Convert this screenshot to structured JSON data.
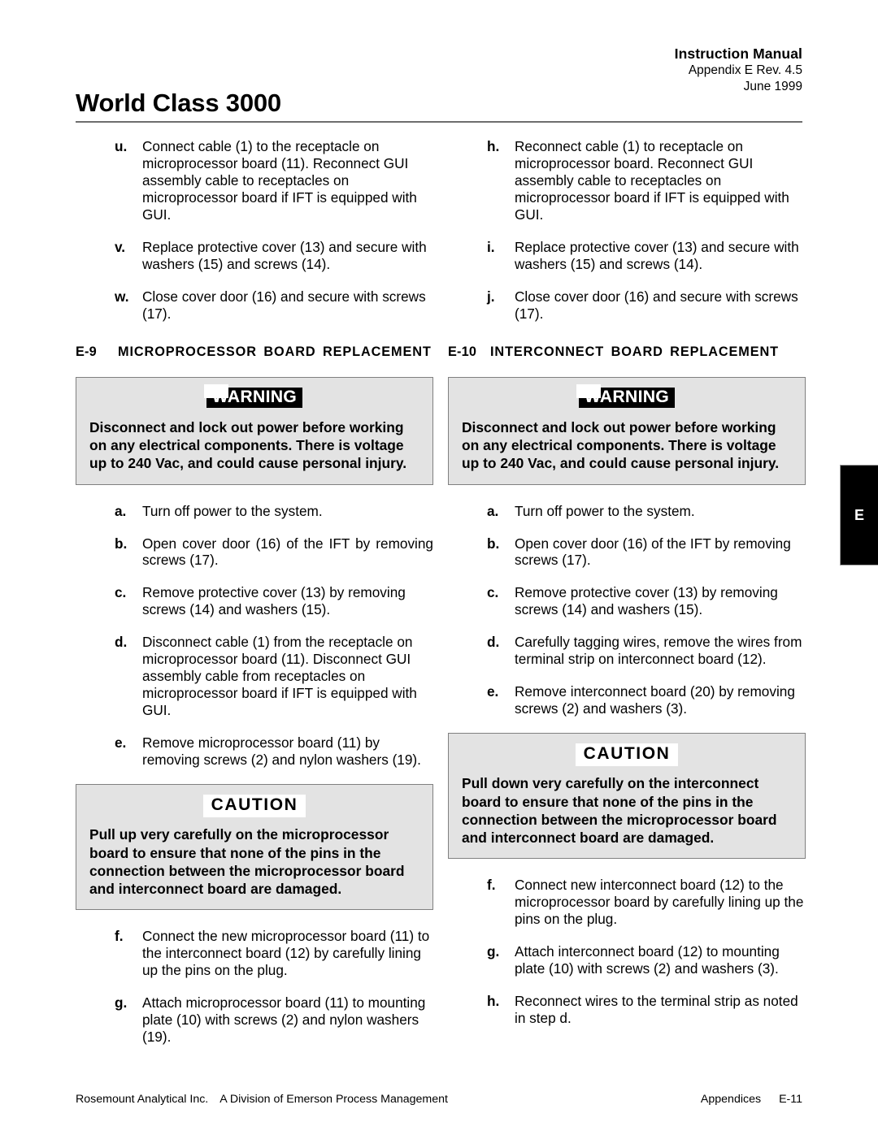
{
  "header": {
    "product_title": "World Class 3000",
    "manual_label": "Instruction Manual",
    "appendix_rev": "Appendix E  Rev. 4.5",
    "date": "June 1999"
  },
  "edge_tab": {
    "label": "E"
  },
  "left_column": {
    "continued_steps": [
      {
        "marker": "u.",
        "text": "Connect cable (1) to the receptacle on microprocessor board (11). Reconnect GUI assembly cable to receptacles on microprocessor board if IFT is equipped with GUI."
      },
      {
        "marker": "v.",
        "text": "Replace protective cover (13) and secure with washers (15) and screws (14)."
      },
      {
        "marker": "w.",
        "text": "Close cover door (16) and secure with screws (17)."
      }
    ],
    "section": {
      "number": "E-9",
      "title": "MICROPROCESSOR BOARD REPLACEMENT"
    },
    "warning": {
      "banner": "WARNING",
      "text": "Disconnect and lock out power before working on any electrical components. There is voltage up to 240 Vac, and could cause personal injury."
    },
    "steps_before_caution": [
      {
        "marker": "a.",
        "text": "Turn off power to the system."
      },
      {
        "marker": "b.",
        "text": "Open cover door (16) of the IFT by removing screws (17)."
      },
      {
        "marker": "c.",
        "text": "Remove protective cover (13) by removing screws (14) and washers (15)."
      },
      {
        "marker": "d.",
        "text": "Disconnect cable (1) from the receptacle on microprocessor board (11). Disconnect GUI assembly cable from receptacles on microprocessor board if IFT is equipped with GUI."
      },
      {
        "marker": "e.",
        "text": "Remove microprocessor board (11) by removing screws (2) and nylon washers (19)."
      }
    ],
    "caution": {
      "banner": "CAUTION",
      "text": "Pull up very carefully on the microprocessor board to ensure that none of the pins in the connection between the microprocessor board and interconnect board are damaged."
    },
    "steps_after_caution": [
      {
        "marker": "f.",
        "text": "Connect the new microprocessor board (11) to the interconnect board (12) by carefully lining up the pins on the plug."
      },
      {
        "marker": "g.",
        "text": "Attach microprocessor board (11) to mounting plate (10) with screws (2) and nylon washers (19)."
      }
    ]
  },
  "right_column": {
    "continued_steps": [
      {
        "marker": "h.",
        "text": "Reconnect cable (1) to receptacle on microprocessor board. Reconnect GUI assembly cable to receptacles on microprocessor board if IFT is equipped with GUI."
      },
      {
        "marker": "i.",
        "text": "Replace protective cover (13) and secure with washers (15) and screws (14)."
      },
      {
        "marker": "j.",
        "text": "Close cover door (16) and secure with screws (17)."
      }
    ],
    "section": {
      "number": "E-10",
      "title": "INTERCONNECT BOARD REPLACEMENT"
    },
    "warning": {
      "banner": "WARNING",
      "text": "Disconnect and lock out power before working on any electrical components. There is voltage up to 240 Vac, and could cause personal injury."
    },
    "steps_before_caution": [
      {
        "marker": "a.",
        "text": "Turn off power to the system."
      },
      {
        "marker": "b.",
        "text": "Open cover door (16) of the IFT by removing screws (17)."
      },
      {
        "marker": "c.",
        "text": "Remove protective cover (13) by removing screws (14) and washers (15)."
      },
      {
        "marker": "d.",
        "text": "Carefully tagging wires, remove the wires from terminal strip on interconnect board (12)."
      },
      {
        "marker": "e.",
        "text": "Remove interconnect board (20) by removing screws (2) and washers (3)."
      }
    ],
    "caution": {
      "banner": "CAUTION",
      "text": "Pull down very carefully on the interconnect board to ensure that none of the pins in the connection between the microprocessor board and interconnect board are damaged."
    },
    "steps_after_caution": [
      {
        "marker": "f.",
        "text": "Connect new interconnect board (12) to the microprocessor board by carefully lining up the pins on the plug."
      },
      {
        "marker": "g.",
        "text": "Attach interconnect board (12) to mounting plate (10) with screws (2) and washers (3)."
      },
      {
        "marker": "h.",
        "text": "Reconnect wires to the terminal strip as noted in step d."
      }
    ]
  },
  "footer": {
    "company": "Rosemount Analytical Inc.",
    "division": "A Division of Emerson Process Management",
    "section_label": "Appendices",
    "page_number": "E-11"
  }
}
